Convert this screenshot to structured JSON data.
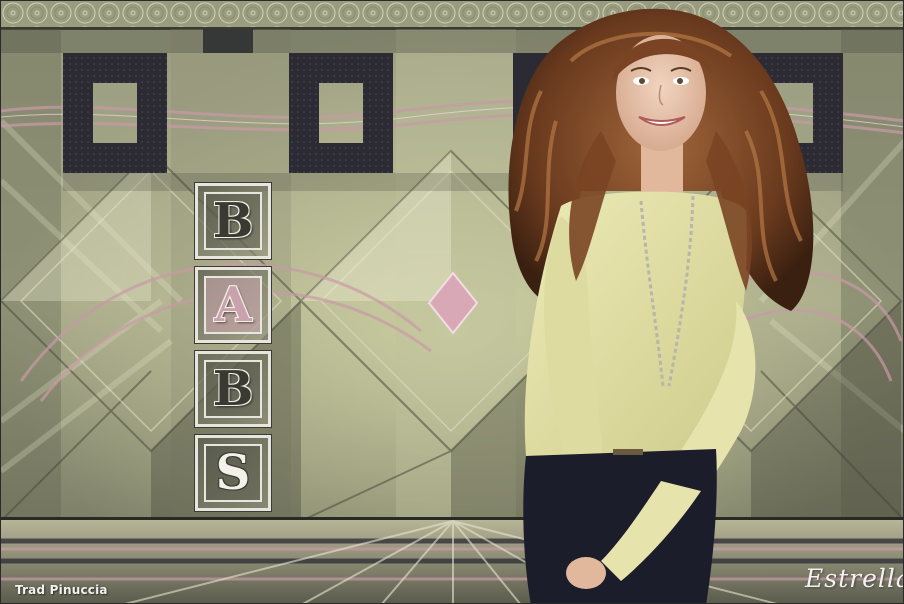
{
  "artwork": {
    "palette": {
      "olive": "#8a8c70",
      "pale_olive": "#c8c9a6",
      "dusty_pink": "#c9a0a8",
      "charcoal": "#2c2b34",
      "sweater_yellow": "#e4e2a6",
      "jeans_navy": "#1c1d2a",
      "hair_brown": "#7a4424"
    },
    "blocks": [
      "B",
      "A",
      "B",
      "S"
    ],
    "credit_text": "Trad Pinuccia",
    "signature_text": "Estrella"
  }
}
